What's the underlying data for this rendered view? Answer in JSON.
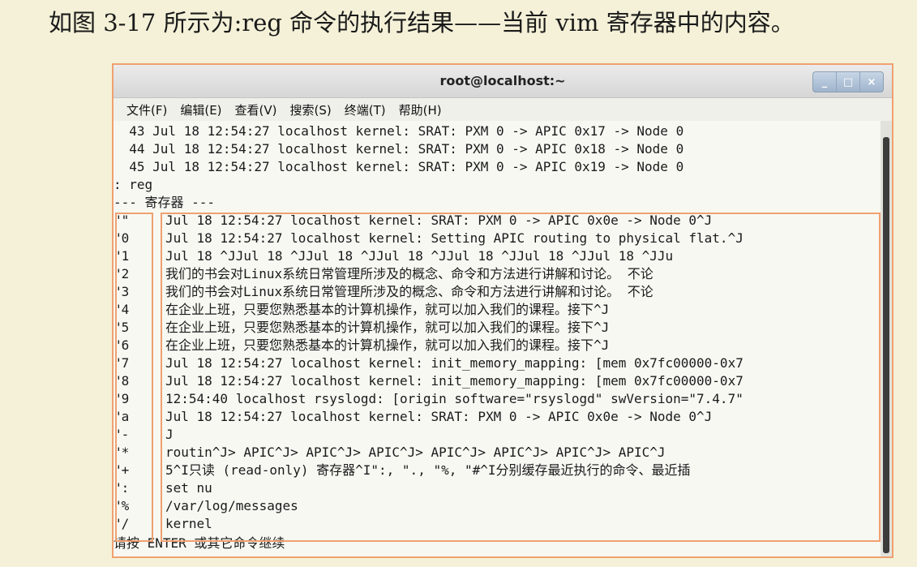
{
  "caption": "如图 3-17 所示为:reg 命令的执行结果——当前 vim 寄存器中的内容。",
  "window": {
    "title": "root@localhost:~",
    "controls": [
      "_",
      "□",
      "×"
    ]
  },
  "menu": [
    "文件(F)",
    "编辑(E)",
    "查看(V)",
    "搜索(S)",
    "终端(T)",
    "帮助(H)"
  ],
  "log_lines": [
    "  43 Jul 18 12:54:27 localhost kernel: SRAT: PXM 0 -> APIC 0x17 -> Node 0",
    "  44 Jul 18 12:54:27 localhost kernel: SRAT: PXM 0 -> APIC 0x18 -> Node 0",
    "  45 Jul 18 12:54:27 localhost kernel: SRAT: PXM 0 -> APIC 0x19 -> Node 0"
  ],
  "command": ": reg",
  "registers_header": "--- 寄存器 ---",
  "registers": [
    {
      "name": "\"\"",
      "content": "Jul 18 12:54:27 localhost kernel: SRAT: PXM 0 -> APIC 0x0e -> Node 0^J"
    },
    {
      "name": "\"0",
      "content": "Jul 18 12:54:27 localhost kernel: Setting APIC routing to physical flat.^J"
    },
    {
      "name": "\"1",
      "content": "Jul 18 ^JJul 18 ^JJul 18 ^JJul 18 ^JJul 18 ^JJul 18 ^JJul 18 ^JJu"
    },
    {
      "name": "\"2",
      "content": "我们的书会对Linux系统日常管理所涉及的概念、命令和方法进行讲解和讨论。 不论"
    },
    {
      "name": "\"3",
      "content": "我们的书会对Linux系统日常管理所涉及的概念、命令和方法进行讲解和讨论。 不论"
    },
    {
      "name": "\"4",
      "content": "在企业上班，只要您熟悉基本的计算机操作，就可以加入我们的课程。接下^J"
    },
    {
      "name": "\"5",
      "content": "在企业上班，只要您熟悉基本的计算机操作，就可以加入我们的课程。接下^J"
    },
    {
      "name": "\"6",
      "content": "在企业上班，只要您熟悉基本的计算机操作，就可以加入我们的课程。接下^J"
    },
    {
      "name": "\"7",
      "content": "Jul 18 12:54:27 localhost kernel: init_memory_mapping: [mem 0x7fc00000-0x7"
    },
    {
      "name": "\"8",
      "content": "Jul 18 12:54:27 localhost kernel: init_memory_mapping: [mem 0x7fc00000-0x7"
    },
    {
      "name": "\"9",
      "content": "12:54:40 localhost rsyslogd: [origin software=\"rsyslogd\" swVersion=\"7.4.7\""
    },
    {
      "name": "\"a",
      "content": "Jul 18 12:54:27 localhost kernel: SRAT: PXM 0 -> APIC 0x0e -> Node 0^J"
    },
    {
      "name": "\"-",
      "content": "J"
    },
    {
      "name": "\"*",
      "content": "routin^J> APIC^J> APIC^J> APIC^J> APIC^J> APIC^J> APIC^J> APIC^J"
    },
    {
      "name": "\"+",
      "content": "5^I只读 (read-only) 寄存器^I\":, \"., \"%, \"#^I分别缓存最近执行的命令、最近插"
    },
    {
      "name": "\":",
      "content": "set nu"
    },
    {
      "name": "\"%",
      "content": "/var/log/messages"
    },
    {
      "name": "\"/",
      "content": "kernel"
    }
  ],
  "prompt": "请按 ENTER 或其它命令继续"
}
